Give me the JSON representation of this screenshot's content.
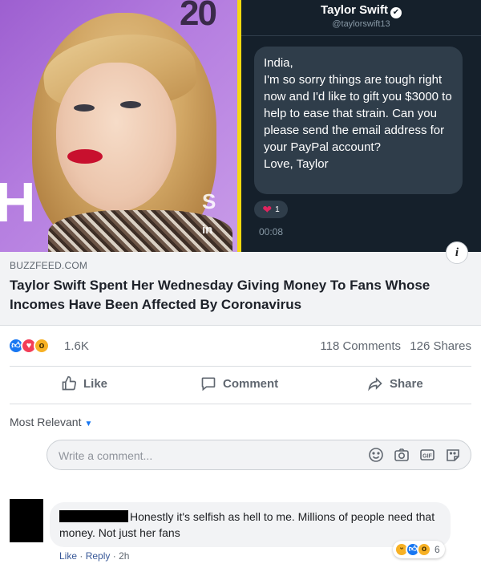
{
  "dm_card": {
    "name": "Taylor Swift",
    "handle": "@taylorswift13",
    "message_lines": [
      "India,",
      "I'm so sorry things are tough right now and I'd like to gift you $3000 to help to ease that strain. Can you please send the email address for your PayPal account?",
      "Love, Taylor"
    ],
    "reaction_count": "1",
    "time": "00:08",
    "year_text": "20",
    "backdrop_letter": "H",
    "backdrop_letters_right": "S",
    "backdrop_letters_in": "in"
  },
  "link_preview": {
    "source": "BUZZFEED.COM",
    "title": "Taylor Swift Spent Her Wednesday Giving Money To Fans Whose Incomes Have Been Affected By Coronavirus"
  },
  "stats": {
    "reactions": "1.6K",
    "comments": "118 Comments",
    "shares": "126 Shares"
  },
  "actions": {
    "like": "Like",
    "comment": "Comment",
    "share": "Share"
  },
  "comments_section": {
    "sort_label": "Most Relevant",
    "write_placeholder": "Write a comment...",
    "comment": {
      "text": "Honestly it's selfish as hell to me. Millions of people need that money. Not just her fans",
      "like": "Like",
      "reply": "Reply",
      "time": "2h",
      "reaction_count": "6"
    }
  },
  "colors": {
    "accent": "#1877f2",
    "dm_background": "#15202b",
    "divider": "#f5d90f"
  }
}
